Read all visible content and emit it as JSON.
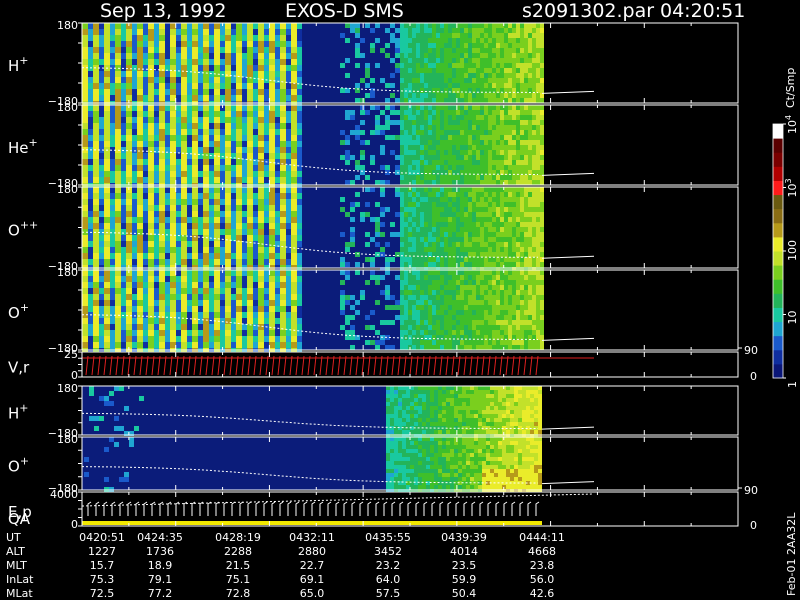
{
  "header": {
    "date": "Sep 13, 1992",
    "instrument": "EXOS-D SMS",
    "file": "s2091302.par",
    "time": "04:20:51"
  },
  "colors": {
    "background": "#000000",
    "plot_background": "#0b1c7a",
    "axis": "#ffffff",
    "trace": "#ffffff",
    "velocity_trace": "#e02020"
  },
  "colorbar": {
    "unit": "Ct/Smp",
    "tick_labels": [
      "1",
      "10",
      "100",
      "10",
      "10"
    ],
    "tick_exponents": [
      "",
      "",
      "",
      "3",
      "4"
    ],
    "tick_values": [
      1,
      10,
      100,
      1000,
      10000
    ],
    "colors": [
      "#0a1678",
      "#0f2ea0",
      "#1a5acb",
      "#1fa6d2",
      "#19c9a0",
      "#23b45a",
      "#3fbf2a",
      "#7acf1e",
      "#c2e12a",
      "#eaec2a",
      "#b69a1a",
      "#8a6d14",
      "#6a5a10",
      "#ff1b1b",
      "#b00000",
      "#7a0000",
      "#5a0000",
      "#ffffff"
    ]
  },
  "panels": [
    {
      "label": "H",
      "sup": "+",
      "ytop": "180",
      "ybot": "−180"
    },
    {
      "label": "He",
      "sup": "+",
      "ytop": "180",
      "ybot": "−180"
    },
    {
      "label": "O",
      "sup": "++",
      "ytop": "180",
      "ybot": "−180"
    },
    {
      "label": "O",
      "sup": "+",
      "ytop": "180",
      "ybot": "−180"
    },
    {
      "label": "V,r",
      "sup": "",
      "ytop": "25",
      "ybot": "0",
      "right_top": "90",
      "right_bot": "0"
    },
    {
      "label": "H",
      "sup": "+",
      "ytop": "180",
      "ybot": "−180"
    },
    {
      "label": "O",
      "sup": "+",
      "ytop": "180",
      "ybot": "−180"
    },
    {
      "label": "E,p",
      "sup": "",
      "label2": "QA",
      "ytop": "4000",
      "ybot": "0",
      "right_top": "90",
      "right_bot": "0"
    }
  ],
  "footer": {
    "rows": [
      {
        "name": "UT",
        "values": [
          "0420:51",
          "0424:35",
          "0428:19",
          "0432:11",
          "0435:55",
          "0439:39",
          "0444:11"
        ]
      },
      {
        "name": "ALT",
        "values": [
          "1227",
          "1736",
          "2288",
          "2880",
          "3452",
          "4014",
          "4668"
        ]
      },
      {
        "name": "MLT",
        "values": [
          "15.7",
          "18.9",
          "21.5",
          "22.7",
          "23.2",
          "23.5",
          "23.8"
        ]
      },
      {
        "name": "InLat",
        "values": [
          "75.3",
          "79.1",
          "75.1",
          "69.1",
          "64.0",
          "59.9",
          "56.0"
        ]
      },
      {
        "name": "MLat",
        "values": [
          "72.5",
          "77.2",
          "72.8",
          "65.0",
          "57.5",
          "50.4",
          "42.6"
        ]
      }
    ],
    "side_note": "Feb-01 2AA32L"
  },
  "chart_data": {
    "type": "heatmap",
    "title": "Sep 13, 1992 EXOS-D SMS",
    "xlabel": "UT",
    "x_ticks": [
      "0420:51",
      "0424:35",
      "0428:19",
      "0432:11",
      "0435:55",
      "0439:39",
      "0444:11"
    ],
    "colorbar_label": "Ct/Smp",
    "colorbar_scale": "log",
    "colorbar_range": [
      1,
      10000
    ],
    "panels": [
      {
        "name": "H+",
        "ylim": [
          -180,
          180
        ]
      },
      {
        "name": "He+",
        "ylim": [
          -180,
          180
        ]
      },
      {
        "name": "O++",
        "ylim": [
          -180,
          180
        ]
      },
      {
        "name": "O+",
        "ylim": [
          -180,
          180
        ]
      },
      {
        "name": "V,r",
        "ylim": [
          0,
          25
        ],
        "right_ylim": [
          0,
          90
        ],
        "type": "line"
      },
      {
        "name": "H+",
        "ylim": [
          -180,
          180
        ]
      },
      {
        "name": "O+",
        "ylim": [
          -180,
          180
        ]
      },
      {
        "name": "E,p / QA",
        "ylim": [
          0,
          4000
        ],
        "right_ylim": [
          0,
          90
        ],
        "type": "line"
      }
    ]
  }
}
